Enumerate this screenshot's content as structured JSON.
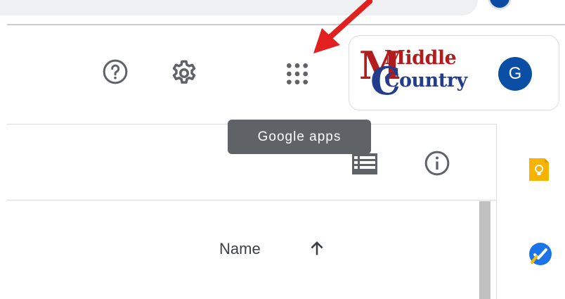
{
  "header": {
    "help_icon": "help-circle-icon",
    "settings_icon": "gear-icon",
    "apps_icon": "grid-dots-icon"
  },
  "account": {
    "logo_text_line1": "Middle",
    "logo_text_line2": "Country",
    "avatar_initial": "G"
  },
  "tooltip": {
    "text": "Google apps"
  },
  "toolbar": {
    "list_view_icon": "list-view-icon",
    "info_icon": "info-icon"
  },
  "file_list": {
    "column_name": "Name",
    "sort_direction": "ascending"
  },
  "side_panel": {
    "apps": [
      "keep-icon",
      "tasks-icon"
    ]
  },
  "annotation": {
    "arrow_color": "#e32020"
  },
  "colors": {
    "tooltip_bg": "#5f6368",
    "avatar_bg": "#0b4ea6",
    "keep_yellow": "#f6b400",
    "tasks_blue": "#1a73e8"
  }
}
